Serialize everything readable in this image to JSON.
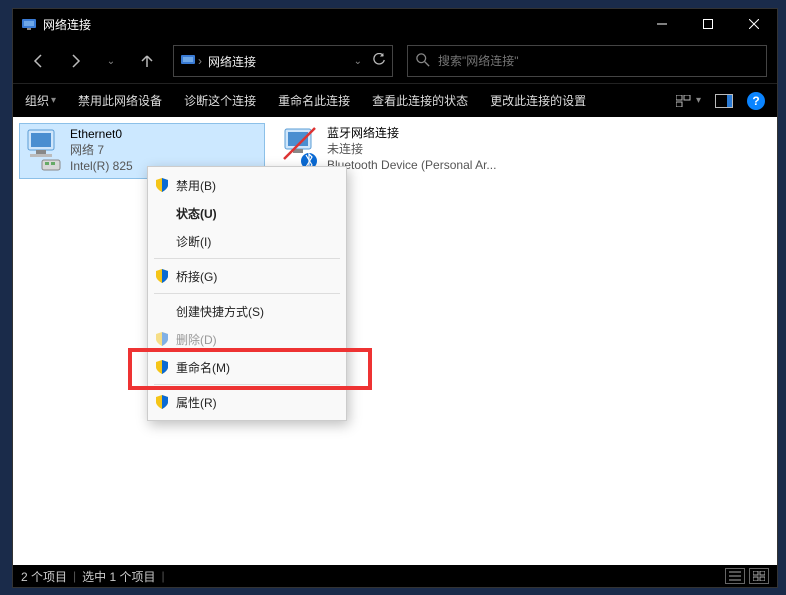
{
  "title": "网络连接",
  "breadcrumb": {
    "item": "网络连接"
  },
  "search": {
    "placeholder": "搜索\"网络连接\""
  },
  "toolbar": {
    "organize": "组织",
    "disable": "禁用此网络设备",
    "diagnose": "诊断这个连接",
    "rename": "重命名此连接",
    "status": "查看此连接的状态",
    "change": "更改此连接的设置"
  },
  "connections": {
    "ethernet": {
      "name": "Ethernet0",
      "sub1": "网络 7",
      "sub2": "Intel(R) 825"
    },
    "bluetooth": {
      "name": "蓝牙网络连接",
      "sub1": "未连接",
      "sub2": "Bluetooth Device (Personal Ar..."
    }
  },
  "menu": {
    "disable": "禁用(B)",
    "state": "状态(U)",
    "diagnose": "诊断(I)",
    "bridge": "桥接(G)",
    "shortcut": "创建快捷方式(S)",
    "delete": "删除(D)",
    "rename": "重命名(M)",
    "properties": "属性(R)"
  },
  "statusbar": {
    "count": "2 个项目",
    "selected": "选中 1 个项目"
  }
}
